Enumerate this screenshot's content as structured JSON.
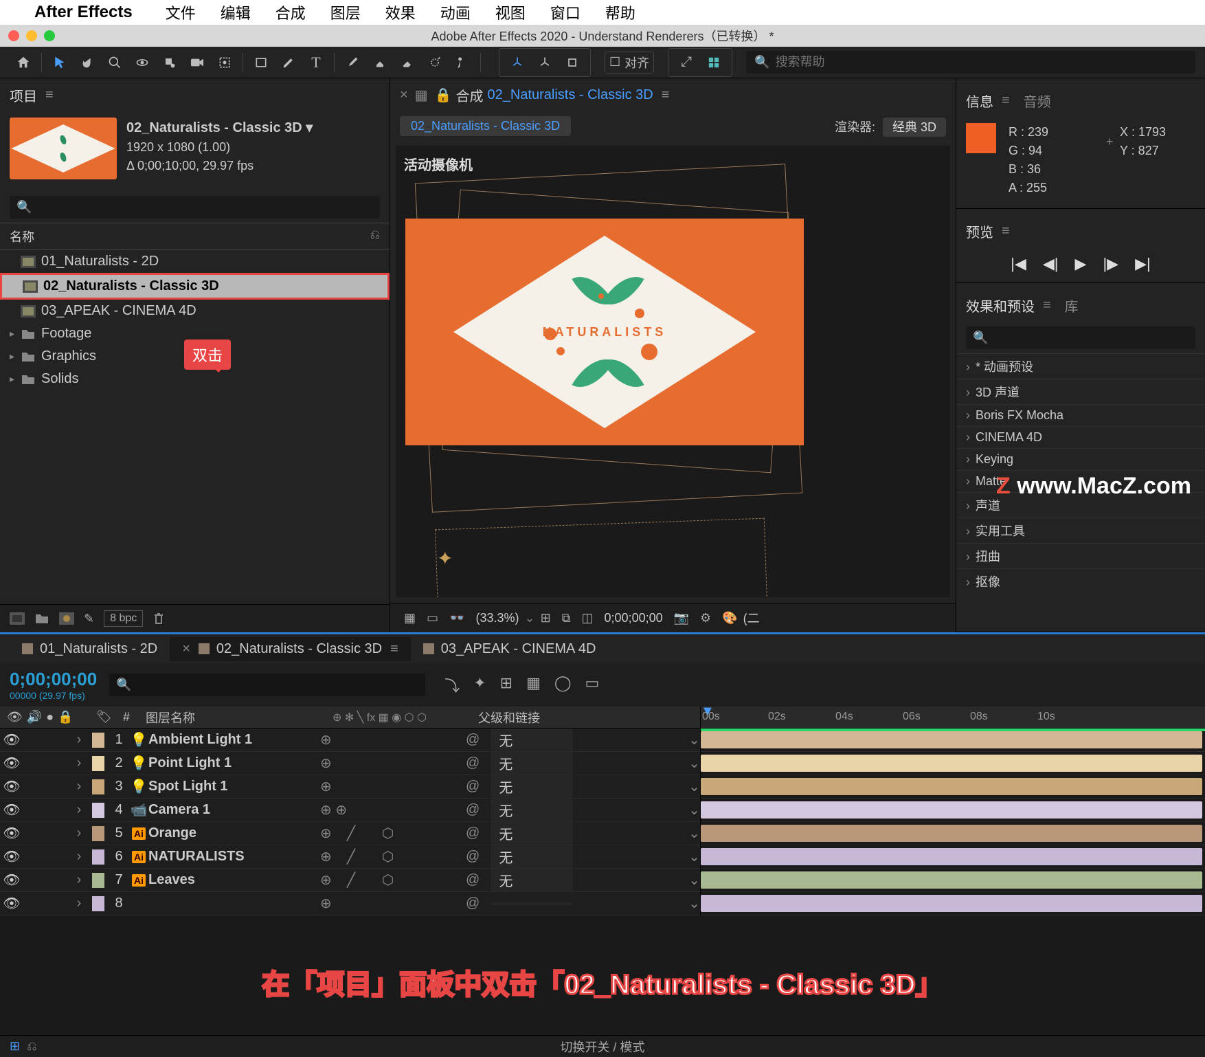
{
  "menubar": {
    "app": "After Effects",
    "items": [
      "文件",
      "编辑",
      "合成",
      "图层",
      "效果",
      "动画",
      "视图",
      "窗口",
      "帮助"
    ]
  },
  "window": {
    "title": "Adobe After Effects 2020 - Understand Renderers（已转换） *"
  },
  "toolbar": {
    "align_label": "对齐",
    "search_placeholder": "搜索帮助"
  },
  "project": {
    "tab": "项目",
    "name": "02_Naturalists - Classic 3D ▾",
    "dims": "1920 x 1080 (1.00)",
    "duration": "Δ 0;00;10;00, 29.97 fps",
    "col_header": "名称",
    "items": [
      {
        "name": "01_Naturalists - 2D",
        "type": "comp"
      },
      {
        "name": "02_Naturalists - Classic 3D",
        "type": "comp",
        "selected": true
      },
      {
        "name": "03_APEAK - CINEMA 4D",
        "type": "comp"
      },
      {
        "name": "Footage",
        "type": "folder"
      },
      {
        "name": "Graphics",
        "type": "folder"
      },
      {
        "name": "Solids",
        "type": "folder"
      }
    ],
    "footer_bpc": "8 bpc",
    "callout": "双击"
  },
  "comp": {
    "tab_prefix": "合成",
    "tab_name": "02_Naturalists - Classic 3D",
    "breadcrumb": "02_Naturalists - Classic 3D",
    "renderer_label": "渲染器:",
    "renderer_value": "经典 3D",
    "viewer_label": "活动摄像机",
    "naturalist_text": "NATURALISTS",
    "zoom": "(33.3%)",
    "timecode": "0;00;00;00",
    "display_mode": "(二"
  },
  "info": {
    "tab": "信息",
    "audio_tab": "音频",
    "swatch": "#ef5e24",
    "r": "R :   239",
    "g": "G :   94",
    "b": "B :   36",
    "a": "A :   255",
    "x": "X : 1793",
    "y": "Y :   827"
  },
  "preview": {
    "tab": "预览"
  },
  "effects": {
    "tab": "效果和预设",
    "lib_tab": "库",
    "rows": [
      "* 动画预设",
      "3D 声道",
      "Boris FX Mocha",
      "CINEMA 4D",
      "Keying",
      "Matte",
      "声道",
      "实用工具",
      "扭曲",
      "抠像"
    ]
  },
  "watermark": "www.MacZ.com",
  "timeline": {
    "tabs": [
      {
        "label": "01_Naturalists - 2D",
        "active": false
      },
      {
        "label": "02_Naturalists - Classic 3D",
        "active": true
      },
      {
        "label": "03_APEAK - CINEMA 4D",
        "active": false
      }
    ],
    "timecode": "0;00;00;00",
    "timecode_sub": "00000 (29.97 fps)",
    "col_layer_name": "图层名称",
    "col_parent": "父级和链接",
    "ruler": [
      "00s",
      "02s",
      "04s",
      "06s",
      "08s",
      "10s"
    ],
    "layers": [
      {
        "num": 1,
        "name": "Ambient Light 1",
        "icon": "light",
        "color": "#d4b896",
        "parent": "无"
      },
      {
        "num": 2,
        "name": "Point Light 1",
        "icon": "light",
        "color": "#e8d4a8",
        "parent": "无"
      },
      {
        "num": 3,
        "name": "Spot Light 1",
        "icon": "light",
        "color": "#c8a878",
        "parent": "无"
      },
      {
        "num": 4,
        "name": "Camera 1",
        "icon": "camera",
        "color": "#d4c8e0",
        "parent": "无"
      },
      {
        "num": 5,
        "name": "Orange",
        "icon": "ai",
        "color": "#b89878",
        "parent": "无"
      },
      {
        "num": 6,
        "name": "NATURALISTS",
        "icon": "ai",
        "color": "#c8b8d8",
        "parent": "无"
      },
      {
        "num": 7,
        "name": "Leaves",
        "icon": "ai",
        "color": "#a8b890",
        "parent": "无"
      },
      {
        "num": 8,
        "name": "",
        "icon": "",
        "color": "#c8b8d8",
        "parent": ""
      }
    ],
    "bottom_center": "切换开关 / 模式"
  },
  "caption": "在「项目」面板中双击「02_Naturalists - Classic 3D」"
}
